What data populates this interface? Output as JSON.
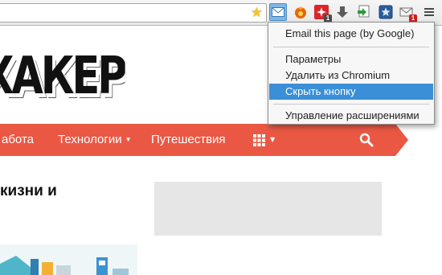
{
  "context_menu": {
    "items": [
      {
        "label": "Email this page (by Google)"
      },
      {
        "label": "Параметры"
      },
      {
        "label": "Удалить из Chromium"
      },
      {
        "label": "Скрыть кнопку"
      },
      {
        "label": "Управление расширениями"
      }
    ],
    "highlighted_index": 3
  },
  "toolbar": {
    "extension_badges": {
      "red_ext": "1",
      "mail_ext": "1"
    }
  },
  "site": {
    "logo_text": "ХАКЕР",
    "nav": {
      "items": [
        {
          "label": "абота"
        },
        {
          "label": "Технологии"
        },
        {
          "label": "Путешествия"
        }
      ]
    },
    "headline_fragment": "кизни и"
  },
  "colors": {
    "nav_background": "#ea5844",
    "menu_highlight": "#3a8fd6",
    "bookmark_star": "#f6c432"
  },
  "icons": [
    "bookmark-star-icon",
    "email-extension-icon",
    "firefox-like-extension-icon",
    "red-extension-icon",
    "download-arrow-icon",
    "green-extension-icon",
    "blue-star-extension-icon",
    "mail-extension-icon",
    "chrome-menu-icon",
    "grid-icon",
    "search-icon",
    "caret-down-icon"
  ]
}
